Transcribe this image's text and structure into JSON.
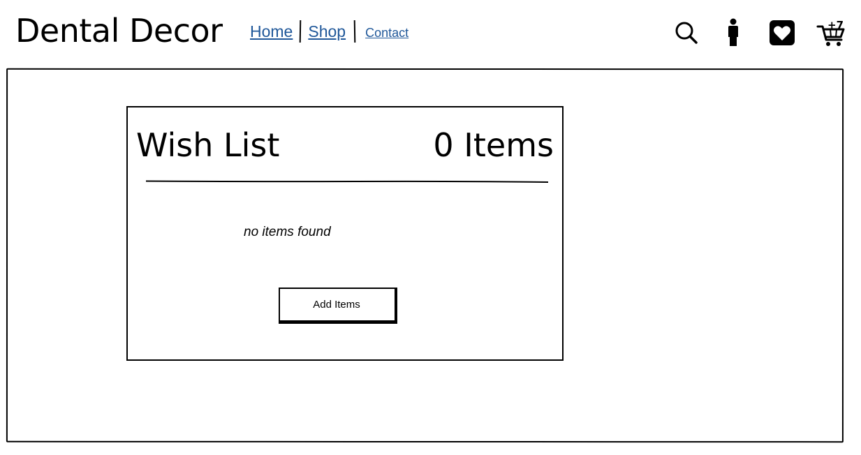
{
  "header": {
    "brand": "Dental Decor",
    "nav": [
      {
        "label": "Home"
      },
      {
        "label": "Shop"
      },
      {
        "label": "Contact"
      }
    ],
    "icons": {
      "search": "search-icon",
      "account": "user-icon",
      "wishlist": "heart-icon",
      "cart": "cart-icon",
      "cart_badge": "+7"
    }
  },
  "wishlist": {
    "title": "Wish List",
    "count_label": "0 Items",
    "empty_message": "no items found",
    "add_button_label": "Add Items"
  }
}
